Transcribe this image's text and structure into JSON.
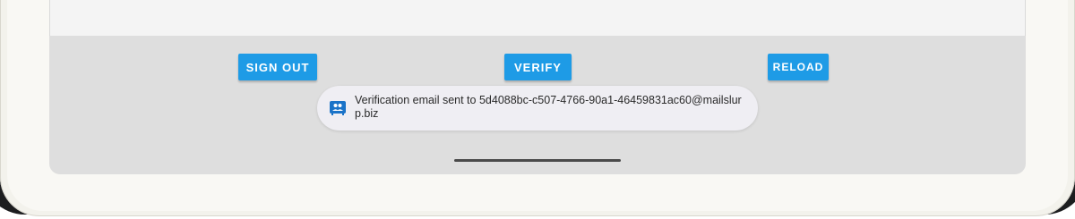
{
  "buttons": {
    "sign_out": "SIGN OUT",
    "verify": "VERIFY",
    "reload": "RELOAD"
  },
  "toast": {
    "icon": "contacts-app-icon",
    "message": "Verification email sent to 5d4088bc-c507-4766-90a1-46459831ac60@mailslurp.biz"
  },
  "colors": {
    "accent": "#1e9be6",
    "toast_background": "#efeef3",
    "screen_background": "#dedede"
  }
}
